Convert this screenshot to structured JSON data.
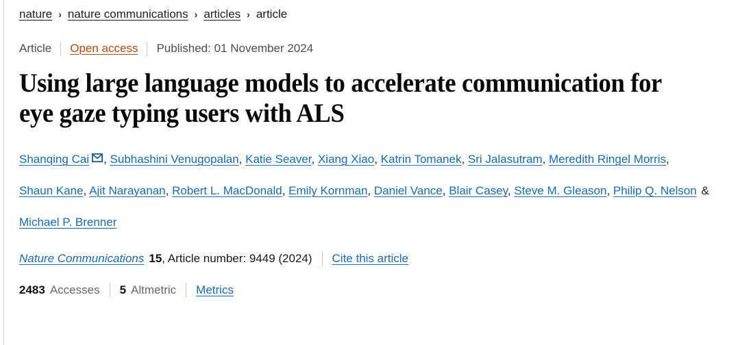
{
  "breadcrumb": {
    "separator": "›",
    "items": [
      {
        "label": "nature",
        "link": true
      },
      {
        "label": "nature communications",
        "link": true
      },
      {
        "label": "articles",
        "link": true
      },
      {
        "label": "article",
        "link": false
      }
    ]
  },
  "meta": {
    "article_type": "Article",
    "open_access": "Open access",
    "published": "Published: 01 November 2024",
    "open_access_color": "#bb4b10"
  },
  "title": "Using large language models to accelerate communication for eye gaze typing users with ALS",
  "authors": {
    "corresponding_icon": "envelope-icon",
    "list": [
      "Shanqing Cai",
      "Subhashini Venugopalan",
      "Katie Seaver",
      "Xiang Xiao",
      "Katrin Tomanek",
      "Sri Jalasutram",
      "Meredith Ringel Morris",
      "Shaun Kane",
      "Ajit Narayanan",
      "Robert L. MacDonald",
      "Emily Kornman",
      "Daniel Vance",
      "Blair Casey",
      "Steve M. Gleason",
      "Philip Q. Nelson",
      "Michael P. Brenner"
    ],
    "ampersand": "&",
    "link_color": "#1a6bb5"
  },
  "citation": {
    "journal": "Nature Communications",
    "volume": "15",
    "details": ", Article number: 9449 (2024)",
    "cite_link": "Cite this article"
  },
  "metrics": {
    "accesses_count": "2483",
    "accesses_label": "Accesses",
    "altmetric_count": "5",
    "altmetric_label": "Altmetric",
    "metrics_link": "Metrics"
  }
}
